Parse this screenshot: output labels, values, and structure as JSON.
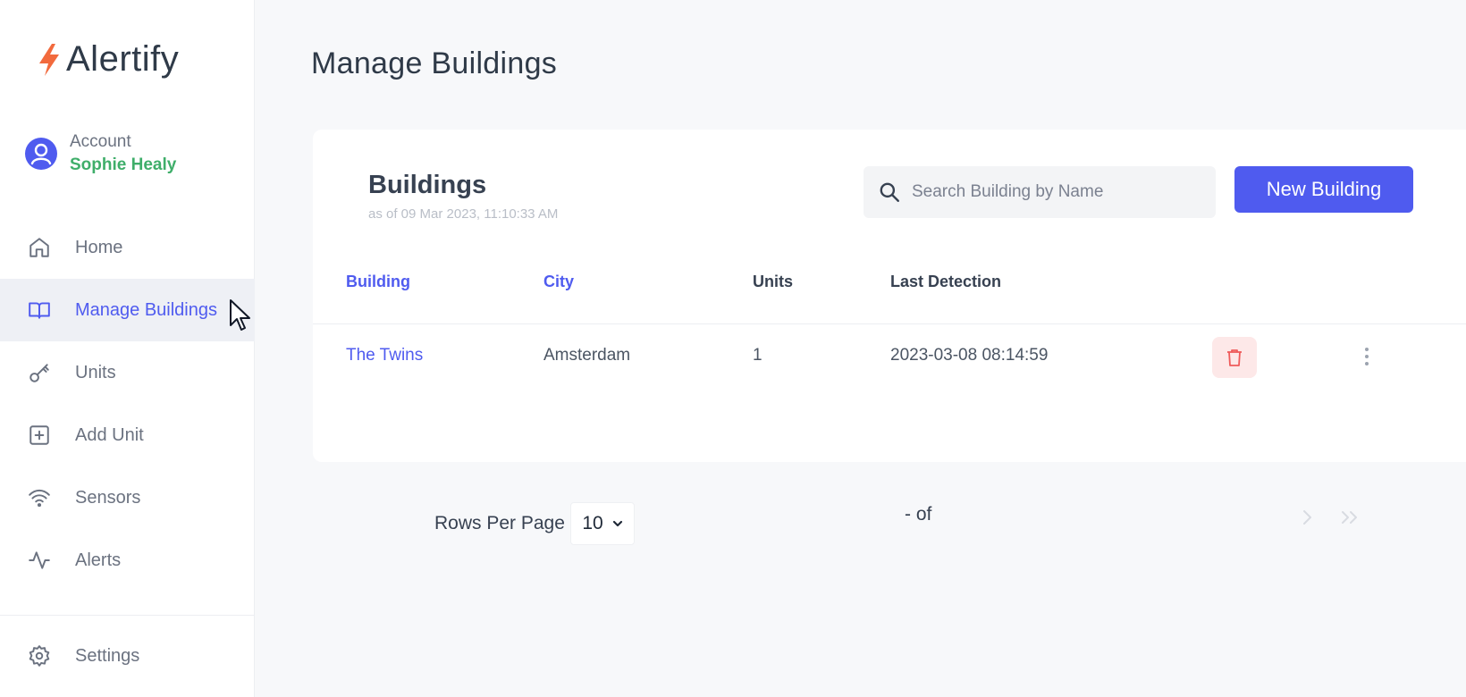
{
  "app": {
    "logo_text": "Alertify",
    "accent_color": "#4f5bef",
    "logo_color": "#f26a3d"
  },
  "account": {
    "label": "Account",
    "name": "Sophie Healy"
  },
  "nav": {
    "items": [
      {
        "label": "Home",
        "icon": "home-icon"
      },
      {
        "label": "Manage Buildings",
        "icon": "book-open-icon",
        "active": true
      },
      {
        "label": "Units",
        "icon": "key-icon"
      },
      {
        "label": "Add Unit",
        "icon": "plus-square-icon"
      },
      {
        "label": "Sensors",
        "icon": "wifi-icon"
      },
      {
        "label": "Alerts",
        "icon": "activity-icon"
      }
    ],
    "settings_label": "Settings"
  },
  "page": {
    "title": "Manage Buildings"
  },
  "card": {
    "title": "Buildings",
    "subtitle": "as of 09 Mar 2023, 11:10:33 AM",
    "search_placeholder": "Search Building by Name",
    "new_button": "New Building"
  },
  "table": {
    "columns": [
      "Building",
      "City",
      "Units",
      "Last Detection"
    ],
    "rows": [
      {
        "building": "The Twins",
        "city": "Amsterdam",
        "units": "1",
        "last_detection": "2023-03-08 08:14:59"
      }
    ]
  },
  "pagination": {
    "rows_per_page_label": "Rows Per Page",
    "rows_per_page_value": "10",
    "range_text": "- of"
  }
}
